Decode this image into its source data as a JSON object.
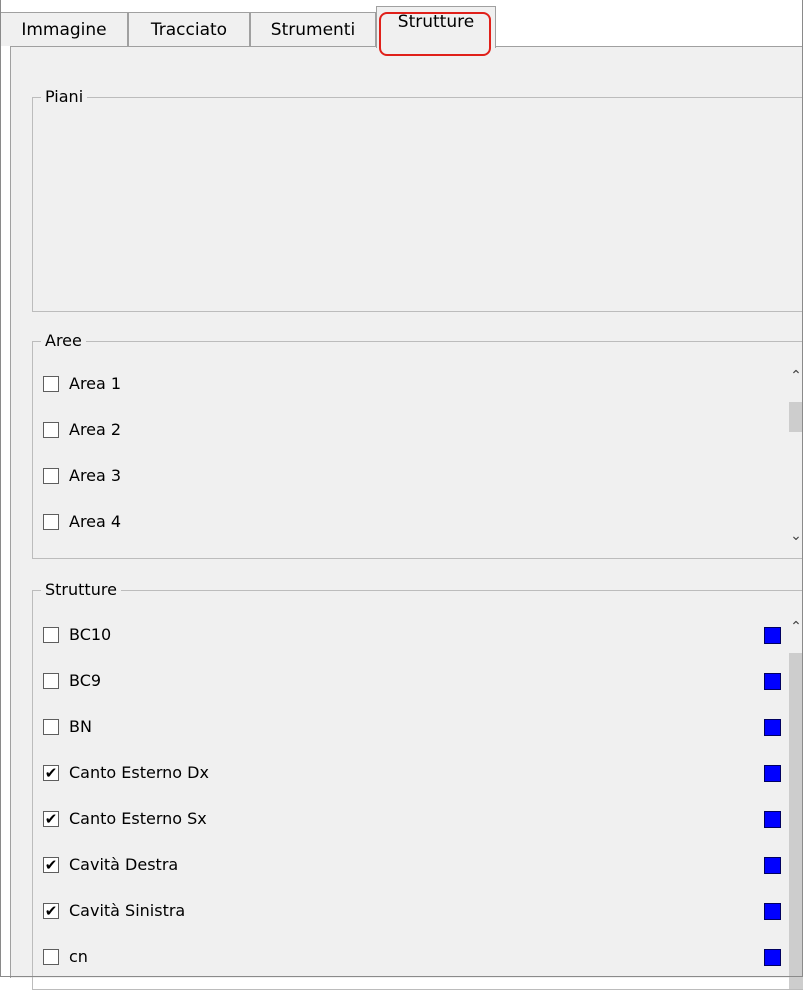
{
  "tabs": [
    {
      "label": "Immagine",
      "active": false
    },
    {
      "label": "Tracciato",
      "active": false
    },
    {
      "label": "Strumenti",
      "active": false
    },
    {
      "label": "Strutture",
      "active": true
    }
  ],
  "groups": {
    "piani": {
      "title": "Piani"
    },
    "aree": {
      "title": "Aree",
      "items": [
        {
          "label": "Area 1",
          "checked": false
        },
        {
          "label": "Area 2",
          "checked": false
        },
        {
          "label": "Area 3",
          "checked": false
        },
        {
          "label": "Area 4",
          "checked": false
        }
      ]
    },
    "strutture": {
      "title": "Strutture",
      "items": [
        {
          "label": "BC10",
          "checked": false,
          "color": "#0000ff"
        },
        {
          "label": "BC9",
          "checked": false,
          "color": "#0000ff"
        },
        {
          "label": "BN",
          "checked": false,
          "color": "#0000ff"
        },
        {
          "label": "Canto Esterno Dx",
          "checked": true,
          "color": "#0000ff"
        },
        {
          "label": "Canto Esterno Sx",
          "checked": true,
          "color": "#0000ff"
        },
        {
          "label": "Cavità Destra",
          "checked": true,
          "color": "#0000ff"
        },
        {
          "label": "Cavità Sinistra",
          "checked": true,
          "color": "#0000ff"
        },
        {
          "label": "cn",
          "checked": false,
          "color": "#0000ff"
        }
      ]
    }
  },
  "icons": {
    "check": "✔",
    "scroll_up": "⌃",
    "scroll_down": "⌄"
  }
}
